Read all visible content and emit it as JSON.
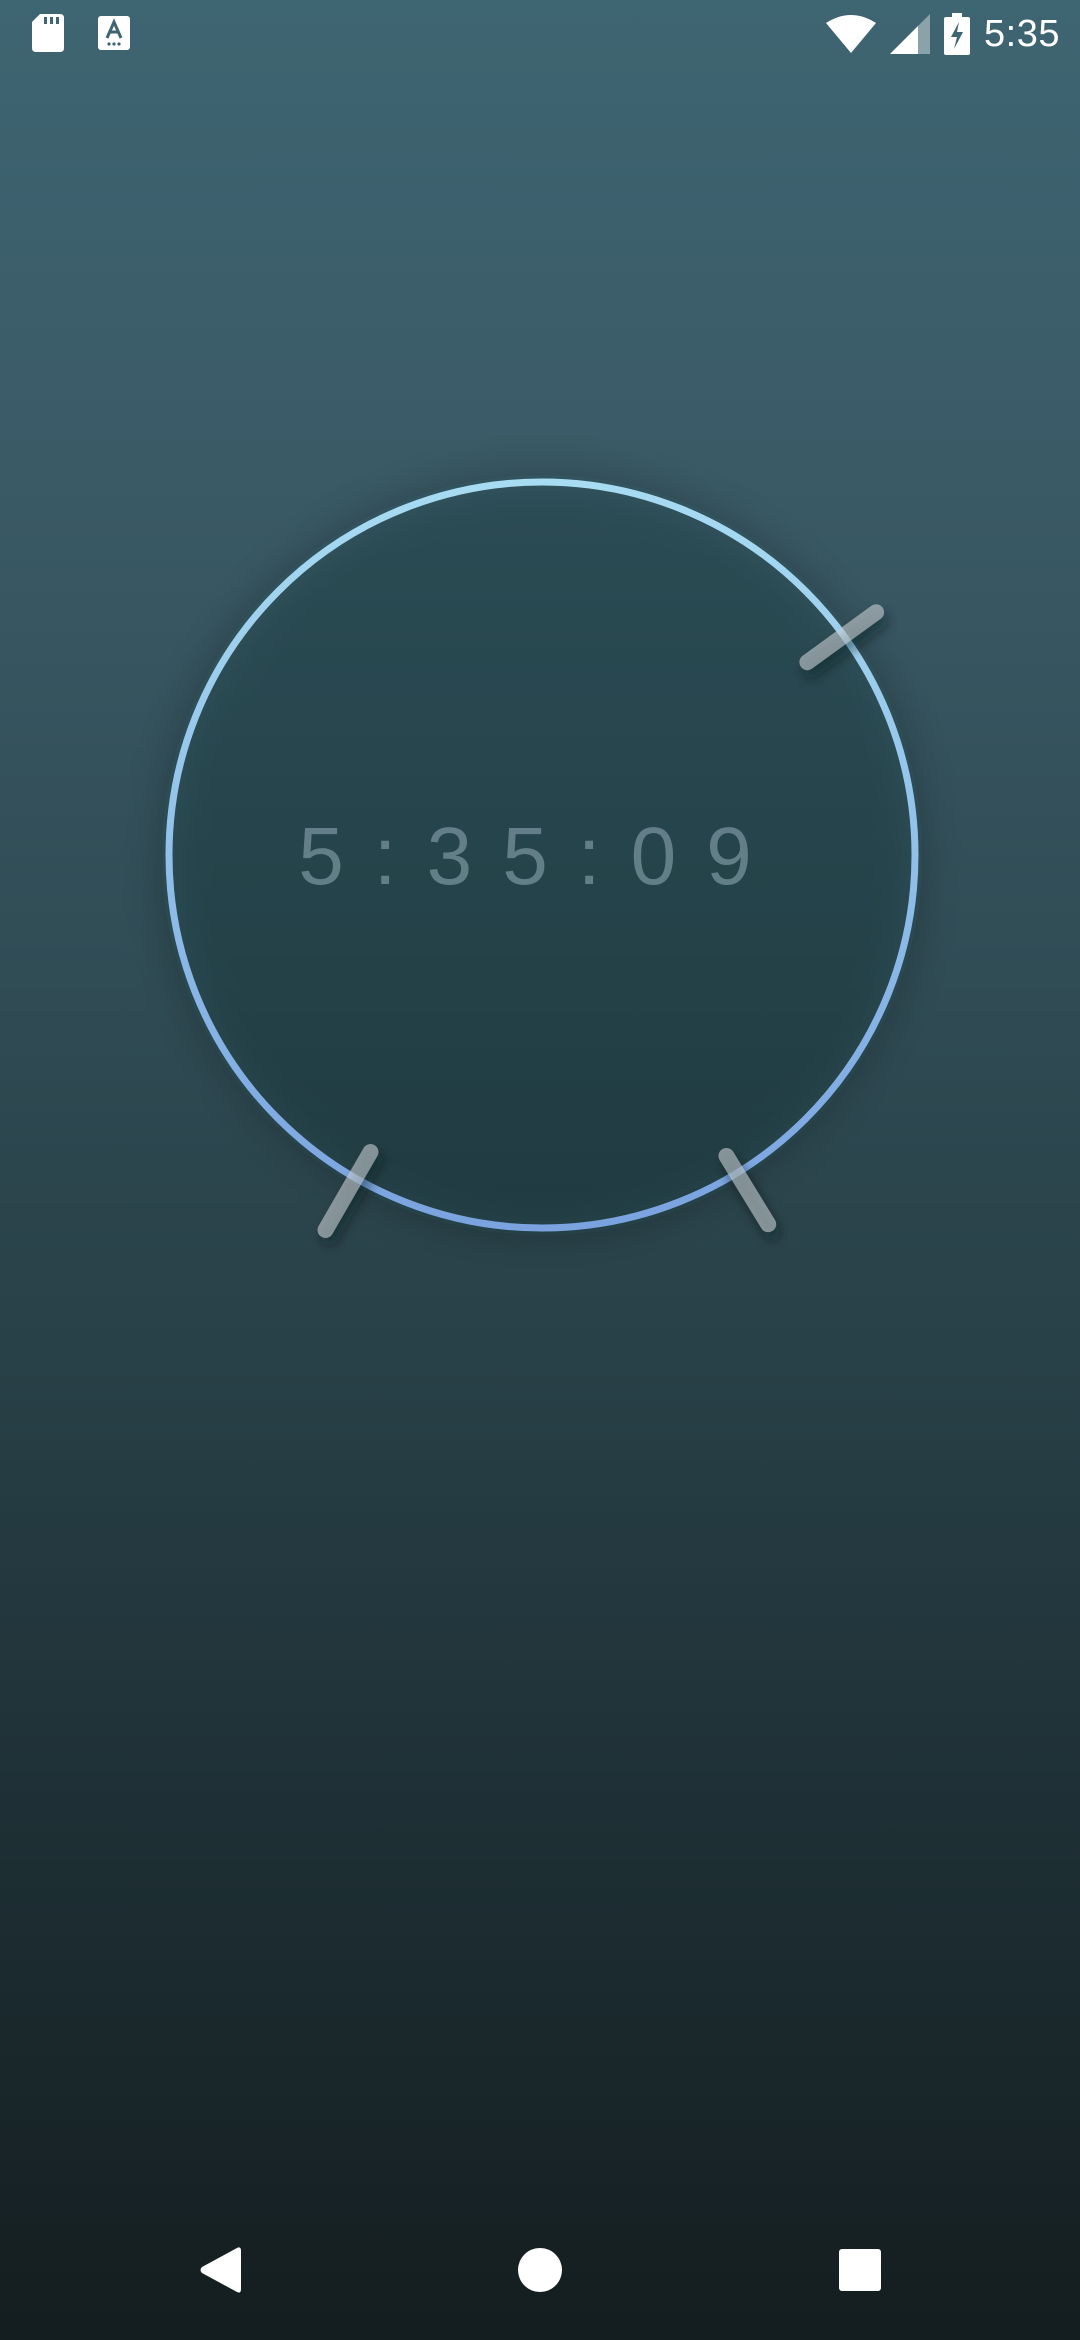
{
  "status_bar": {
    "time": "5:35",
    "left_icons": [
      "sd-card-icon",
      "text-a-icon"
    ],
    "right_icons": [
      "wifi-icon",
      "cell-signal-icon",
      "battery-charging-icon"
    ]
  },
  "clock": {
    "digital_time": "5:35:09",
    "hours": 5,
    "minutes": 35,
    "seconds": 9,
    "ring_gradient_top": "#a8dcf2",
    "ring_gradient_bottom": "#7aa3e0",
    "hand_color": "#c9d1d6"
  },
  "nav_bar": {
    "back_icon": "back-triangle-icon",
    "home_icon": "home-circle-icon",
    "recents_icon": "recents-square-icon"
  }
}
